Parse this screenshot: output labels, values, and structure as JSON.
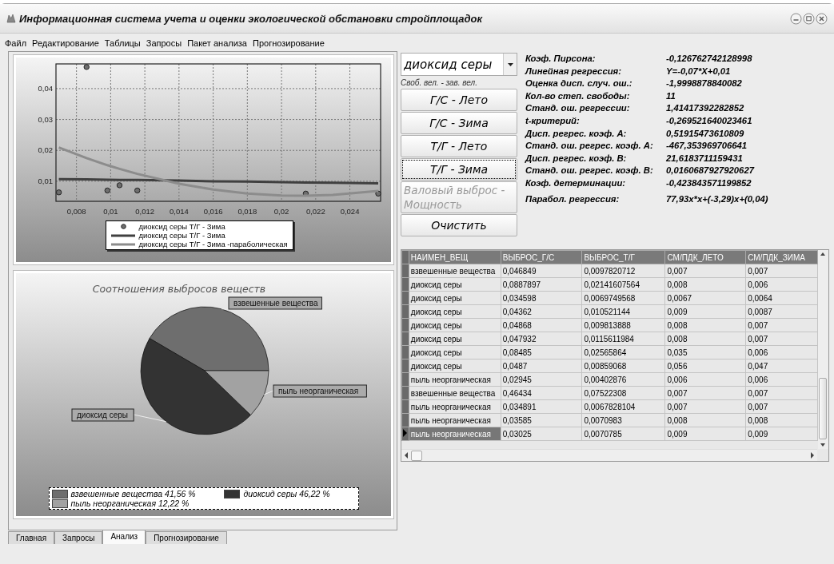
{
  "window": {
    "title": "Информационная система учета и оценки экологической обстановки стройплощадок"
  },
  "menu": [
    "Файл",
    "Редактирование",
    "Таблицы",
    "Запросы",
    "Пакет анализа",
    "Прогнозирование"
  ],
  "regression_chart": {
    "chart_data": {
      "type": "line",
      "x": [
        0.00697,
        0.00859,
        0.00981,
        0.01052,
        0.01156,
        0.014,
        0.016,
        0.018,
        0.02,
        0.02142,
        0.023,
        0.02566
      ],
      "grid": true,
      "legend": true,
      "xlim": [
        0.0068,
        0.0258
      ],
      "ylim": [
        0.0035,
        0.048
      ],
      "xticks": [
        {
          "value": 0.008,
          "label": "0,008"
        },
        {
          "value": 0.01,
          "label": "0,01"
        },
        {
          "value": 0.012,
          "label": "0,012"
        },
        {
          "value": 0.014,
          "label": "0,014"
        },
        {
          "value": 0.016,
          "label": "0,016"
        },
        {
          "value": 0.018,
          "label": "0,018"
        },
        {
          "value": 0.02,
          "label": "0,02"
        },
        {
          "value": 0.022,
          "label": "0,022"
        },
        {
          "value": 0.024,
          "label": "0,024"
        }
      ],
      "yticks": [
        {
          "value": 0.01,
          "label": "0,01"
        },
        {
          "value": 0.02,
          "label": "0,02"
        },
        {
          "value": 0.03,
          "label": "0,03"
        },
        {
          "value": 0.04,
          "label": "0,04"
        }
      ],
      "series": [
        {
          "name": "диоксид серы Т/Г - Зима",
          "type": "scatter",
          "color": "#6e6e6e",
          "values": [
            0.0064,
            0.047,
            0.007,
            0.0087,
            0.007,
            null,
            null,
            null,
            null,
            0.006,
            null,
            0.006
          ]
        },
        {
          "name": "диоксид серы Т/Г - Зима",
          "type": "line",
          "color": "#404040",
          "values": [
            0.0107,
            0.0106,
            0.0105,
            0.0104,
            0.0104,
            0.0102,
            0.01,
            0.0099,
            0.0097,
            0.0096,
            0.0095,
            0.0093
          ]
        },
        {
          "name": "диоксид серы Т/Г - Зима -параболическая",
          "type": "line",
          "color": "#8c8c8c",
          "values": [
            0.0209,
            0.0175,
            0.0152,
            0.014,
            0.0124,
            0.0092,
            0.0073,
            0.006,
            0.0054,
            0.0053,
            0.0056,
            0.0069
          ]
        }
      ]
    }
  },
  "pie_chart": {
    "chart_data": {
      "type": "pie",
      "title": "Соотношения выбросов веществ",
      "categories": [
        "взвешенные вещества",
        "диоксид серы",
        "пыль неорганическая"
      ],
      "values": [
        41.56,
        46.22,
        12.22
      ]
    },
    "legend": [
      {
        "label": "взвешенные вещества 41,56 %",
        "color": "#6e6e6e"
      },
      {
        "label": "диоксид серы 46,22 %",
        "color": "#333333"
      },
      {
        "label": "пыль неорганическая 12,22 %",
        "color": "#a2a2a2"
      }
    ]
  },
  "substance_select": {
    "value": "диоксид серы"
  },
  "variables_caption": "Своб. вел. - зав. вел.",
  "buttons": [
    {
      "label": "Г/С - Лето",
      "selected": false,
      "disabled": false
    },
    {
      "label": "Г/С - Зима",
      "selected": false,
      "disabled": false
    },
    {
      "label": "Т/Г - Лето",
      "selected": false,
      "disabled": false
    },
    {
      "label": "Т/Г - Зима",
      "selected": true,
      "disabled": false
    },
    {
      "label": "Валовый выброс - Мощность",
      "selected": false,
      "disabled": true
    },
    {
      "label": "Очистить",
      "selected": false,
      "disabled": false
    }
  ],
  "statistics": [
    {
      "label": "Коэф. Пирсона:",
      "value": "-0,126762742128998"
    },
    {
      "label": "Линейная регрессия:",
      "value": "Y=-0,07*X+0,01"
    },
    {
      "label": "Оценка дисп. случ. ош.:",
      "value": "-1,9998878840082"
    },
    {
      "label": "Кол-во  степ. свободы:",
      "value": "11"
    },
    {
      "label": "Станд. ош. регрессии:",
      "value": "1,41417392282852"
    },
    {
      "label": "t-критерий:",
      "value": "-0,269521640023461"
    },
    {
      "label": "Дисп. регрес. коэф. А:",
      "value": "0,51915473610809"
    },
    {
      "label": "Станд. ош. регрес. коэф. А:",
      "value": "-467,353969706641"
    },
    {
      "label": "Дисп. регрес. коэф. В:",
      "value": "21,6183711159431"
    },
    {
      "label": "Станд. ош. регрес. коэф. В:",
      "value": "0,0160687927920627"
    },
    {
      "label": "Коэф. детерминации:",
      "value": "-0,423843571199852"
    },
    {
      "label": "Парабол. регрессия:",
      "value": "77,93x*x+(-3,29)x+(0,04)"
    }
  ],
  "table": {
    "columns": [
      "НАИМЕН_ВЕЩ",
      "ВЫБРОС_Г/С",
      "ВЫБРОС_Т/Г",
      "СМ/ПДК_ЛЕТО",
      "СМ/ПДК_ЗИМА"
    ],
    "rows": [
      {
        "cells": [
          "взвешенные вещества",
          "0,046849",
          "0,0097820712",
          "0,007",
          "0,007"
        ],
        "selected": false
      },
      {
        "cells": [
          "диоксид серы",
          "0,0887897",
          "0,02141607564",
          "0,008",
          "0,006"
        ],
        "selected": false
      },
      {
        "cells": [
          "диоксид серы",
          "0,034598",
          "0,0069749568",
          "0,0067",
          "0,0064"
        ],
        "selected": false
      },
      {
        "cells": [
          "диоксид серы",
          "0,04362",
          "0,010521144",
          "0,009",
          "0,0087"
        ],
        "selected": false
      },
      {
        "cells": [
          "диоксид серы",
          "0,04868",
          "0,009813888",
          "0,008",
          "0,007"
        ],
        "selected": false
      },
      {
        "cells": [
          "диоксид серы",
          "0,047932",
          "0,0115611984",
          "0,008",
          "0,007"
        ],
        "selected": false
      },
      {
        "cells": [
          "диоксид серы",
          "0,08485",
          "0,02565864",
          "0,035",
          "0,006"
        ],
        "selected": false
      },
      {
        "cells": [
          "диоксид серы",
          "0,0487",
          "0,00859068",
          "0,056",
          "0,047"
        ],
        "selected": false
      },
      {
        "cells": [
          "пыль неорганическая",
          "0,02945",
          "0,00402876",
          "0,006",
          "0,006"
        ],
        "selected": false
      },
      {
        "cells": [
          "взвешенные вещества",
          "0,46434",
          "0,07522308",
          "0,007",
          "0,007"
        ],
        "selected": false
      },
      {
        "cells": [
          "пыль неорганическая",
          "0,034891",
          "0,0067828104",
          "0,007",
          "0,007"
        ],
        "selected": false
      },
      {
        "cells": [
          "пыль неорганическая",
          "0,03585",
          "0,0070983",
          "0,008",
          "0,008"
        ],
        "selected": false
      },
      {
        "cells": [
          "пыль неорганическая",
          "0,03025",
          "0,0070785",
          "0,009",
          "0,009"
        ],
        "selected": true
      }
    ]
  },
  "tabs": [
    {
      "label": "Главная",
      "selected": false
    },
    {
      "label": "Запросы",
      "selected": false
    },
    {
      "label": "Анализ",
      "selected": true
    },
    {
      "label": "Прогнозирование",
      "selected": false
    }
  ]
}
